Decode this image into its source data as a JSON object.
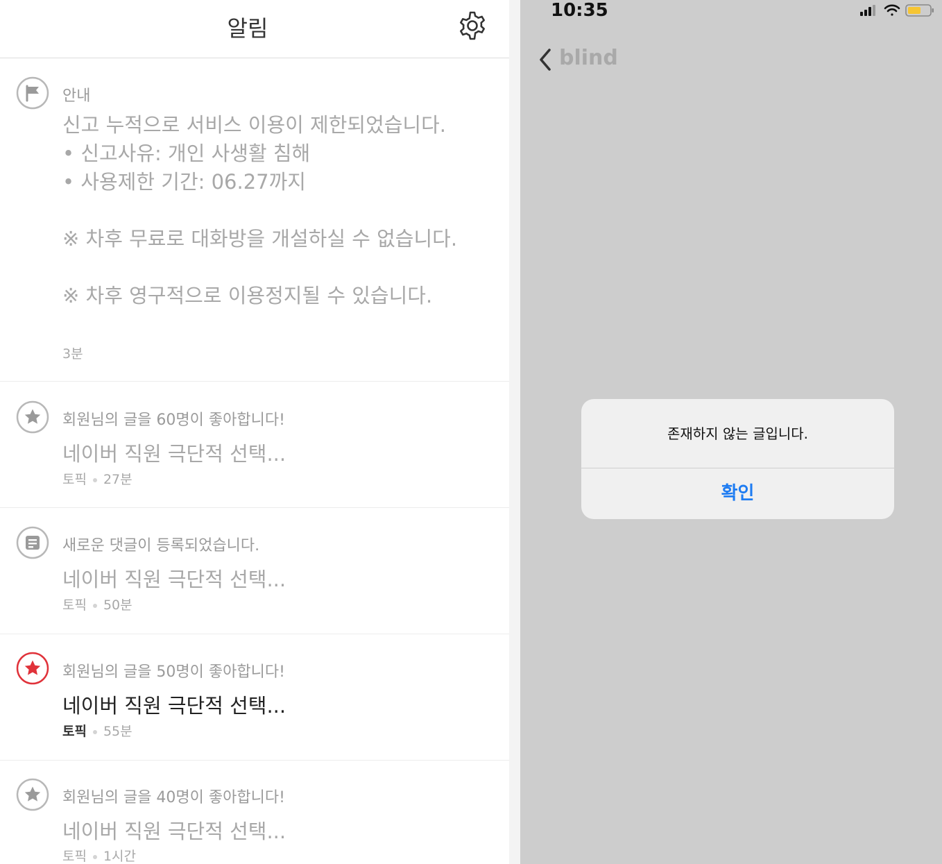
{
  "left": {
    "title": "알림",
    "notifications": [
      {
        "icon": "flag-icon",
        "category": "안내",
        "lines": [
          "신고 누적으로 서비스 이용이 제한되었습니다.",
          "• 신고사유: 개인 사생활 침해",
          "• 사용제한 기간: 06.27까지",
          "",
          "※ 차후 무료로 대화방을 개설하실 수 없습니다.",
          "",
          "※ 차후 영구적으로 이용정지될 수 있습니다."
        ],
        "time": "3분"
      },
      {
        "icon": "star-icon",
        "category": "회원님의 글을 60명이 좋아합니다!",
        "title": "네이버 직원 극단적 선택...",
        "tag": "토픽",
        "time": "27분"
      },
      {
        "icon": "comment-icon",
        "category": "새로운 댓글이 등록되었습니다.",
        "title": "네이버 직원 극단적 선택...",
        "tag": "토픽",
        "time": "50분"
      },
      {
        "icon": "star-icon",
        "category": "회원님의 글을 50명이 좋아합니다!",
        "title": "네이버 직원 극단적 선택...",
        "tag": "토픽",
        "time": "55분",
        "unread": true
      },
      {
        "icon": "star-icon",
        "category": "회원님의 글을 40명이 좋아합니다!",
        "title": "네이버 직원 극단적 선택...",
        "tag": "토픽",
        "time": "1시간"
      }
    ]
  },
  "right": {
    "status_time": "10:35",
    "back_label": "blind",
    "dialog": {
      "message": "존재하지 않는 글입니다.",
      "confirm": "확인"
    }
  },
  "colors": {
    "accent_blue": "#1e7cf2",
    "unread_red": "#e0323a",
    "overlay_gray": "#cdcdcd",
    "battery_yellow": "#f6c532"
  }
}
